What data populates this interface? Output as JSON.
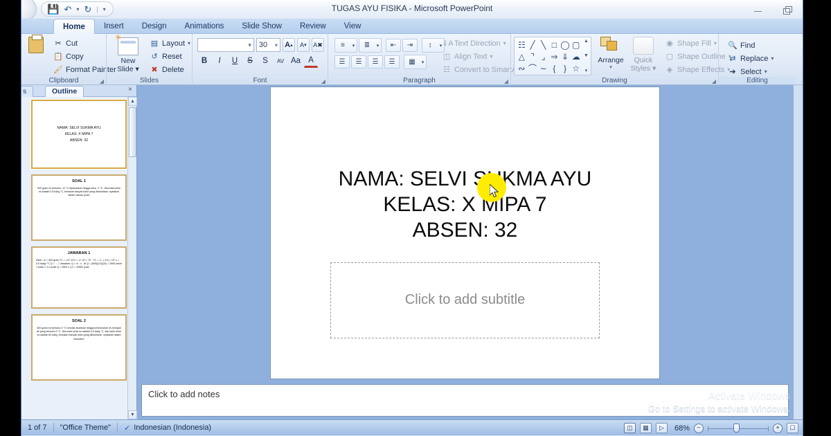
{
  "window": {
    "title": "TUGAS AYU FISIKA  -  Microsoft PowerPoint",
    "minimize": "minimize-icon",
    "restore": "restore-icon"
  },
  "qat": {
    "save": "ὋE",
    "undo": "↶",
    "redo": "↻",
    "more": "▾"
  },
  "tabs": [
    {
      "label": "Home",
      "active": true
    },
    {
      "label": "Insert",
      "active": false
    },
    {
      "label": "Design",
      "active": false
    },
    {
      "label": "Animations",
      "active": false
    },
    {
      "label": "Slide Show",
      "active": false
    },
    {
      "label": "Review",
      "active": false
    },
    {
      "label": "View",
      "active": false
    }
  ],
  "ribbon": {
    "clipboard": {
      "label": "Clipboard",
      "paste": "Paste",
      "items": [
        {
          "label": "Cut",
          "icon": "scissors-icon"
        },
        {
          "label": "Copy",
          "icon": "copy-icon"
        },
        {
          "label": "Format Painter",
          "icon": "format-painter-icon"
        }
      ]
    },
    "slides": {
      "label": "Slides",
      "new_slide": "New\nSlide",
      "new_slide_line1": "New",
      "new_slide_line2": "Slide",
      "items": [
        {
          "label": "Layout",
          "icon": "layout-icon",
          "caret": "▾"
        },
        {
          "label": "Reset",
          "icon": "reset-icon",
          "caret": ""
        },
        {
          "label": "Delete",
          "icon": "delete-icon",
          "caret": ""
        }
      ]
    },
    "font": {
      "label": "Font",
      "font_name": "",
      "font_name_caret": "▾",
      "font_size": "30",
      "font_size_caret": "▾",
      "grow": "A",
      "shrink": "A",
      "clear_formatting": "clear-formatting-icon",
      "buttons": [
        {
          "label": "B",
          "name": "bold-button"
        },
        {
          "label": "I",
          "name": "italic-button"
        },
        {
          "label": "U",
          "name": "underline-button"
        },
        {
          "label": "S",
          "name": "strikethrough-button"
        },
        {
          "label": "S",
          "name": "shadow-button"
        },
        {
          "label": "AV",
          "name": "character-spacing-button"
        },
        {
          "label": "Aa",
          "name": "change-case-button"
        },
        {
          "label": "A",
          "name": "font-color-button"
        }
      ]
    },
    "paragraph": {
      "label": "Paragraph",
      "items": [
        {
          "label": "Text Direction",
          "icon": "text-direction-icon",
          "caret": "▾"
        },
        {
          "label": "Align Text",
          "icon": "align-text-icon",
          "caret": "▾"
        },
        {
          "label": "Convert to SmartArt",
          "icon": "smartart-icon",
          "caret": "▾"
        }
      ],
      "row1": [
        "bullets",
        "numbering",
        "decrease-indent",
        "increase-indent",
        "line-spacing"
      ],
      "row2": [
        "align-left",
        "align-center",
        "align-right",
        "justify",
        "columns"
      ]
    },
    "drawing": {
      "label": "Drawing",
      "arrange": "Arrange",
      "quick_styles_l1": "Quick",
      "quick_styles_l2": "Styles",
      "shapes": [
        [
          "textbox",
          "line",
          "arrow",
          "rectangle",
          "oval",
          "rounded-rect"
        ],
        [
          "triangle",
          "elbow",
          "elbow2",
          "right-arrow",
          "down-arrow",
          "cloud"
        ],
        [
          "freeform",
          "arc",
          "curve",
          "left-brace",
          "right-brace",
          "star"
        ]
      ],
      "items": [
        {
          "label": "Shape Fill",
          "icon": "shape-fill-icon",
          "caret": "▾"
        },
        {
          "label": "Shape Outline",
          "icon": "shape-outline-icon",
          "caret": "▾"
        },
        {
          "label": "Shape Effects",
          "icon": "shape-effects-icon",
          "caret": "▾"
        }
      ]
    },
    "editing": {
      "label": "Editing",
      "items": [
        {
          "label": "Find",
          "icon": "find-icon",
          "caret": ""
        },
        {
          "label": "Replace",
          "icon": "replace-icon",
          "caret": "▾"
        },
        {
          "label": "Select",
          "icon": "select-icon",
          "caret": "▾"
        }
      ]
    }
  },
  "left_pane": {
    "tab_slides": "s",
    "tab_outline": "Outline",
    "close": "×",
    "thumbnails": [
      {
        "number": "",
        "selected": true,
        "type": "title",
        "lines": [
          "NAMA: SELVI SUKMA AYU",
          "KELAS: X MIPA 7",
          "ABSEN: 32"
        ]
      },
      {
        "number": "",
        "selected": false,
        "type": "content",
        "title": "SOAL 1",
        "body": "500 gram es bersuhu -12 °C dipanaskan hingga suhu -2 °C. Jika kalor jenis es adalah 0,5 kal/g °C, tentukan banyak kalor yang dibutuhkan, nyatakan dalam satuan joule!"
      },
      {
        "number": "",
        "selected": false,
        "type": "content",
        "title": "JAWABAN 1",
        "body": "Diket : m = 500 gram T1 = -12° ΔT2 = -2° ΔT = T2 - T1 = -2 - (-12) = 10° c = 0,5 kal/gr °C Q = ... ? Jawaban: Q = m . c . Δt Q = (500)(0,5)(10) = 2500 kalori 1 kalori = 4,2 joule Q = 2500 x 4,2 = 10500 joule"
      },
      {
        "number": "",
        "selected": false,
        "type": "content",
        "title": "SOAL 2",
        "body": "500 gram es bersuhu 0 °C hendak dicairkan hingga keseluruhan es menjadi air yang bersuhu 0 °C. Jika kalor jenis es adalah 0,5 kal/g °C, dan kalor lebur es adalah 80 kal/g, tentukan banyak kalor yang dibutuhkan, nyatakan dalam kilokalori!"
      }
    ]
  },
  "slide": {
    "title_lines": [
      "NAMA: SELVI SUKMA AYU",
      "KELAS: X MIPA 7",
      "ABSEN: 32"
    ],
    "subtitle_placeholder": "Click to add subtitle",
    "cursor": "mouse-cursor"
  },
  "notes": {
    "placeholder": "Click to add notes"
  },
  "watermark": {
    "line1": "Activate Windows",
    "line2": "Go to Settings to activate Windows."
  },
  "status": {
    "slide_counter": "1 of 7",
    "theme": "\"Office Theme\"",
    "spellcheck": "spellcheck-icon",
    "language": "Indonesian (Indonesia)",
    "views": [
      "normal-view",
      "slide-sorter-view",
      "slide-show-view"
    ],
    "zoom": "68%",
    "zoom_out": "−",
    "zoom_in": "+",
    "fit": "fit-to-window"
  }
}
